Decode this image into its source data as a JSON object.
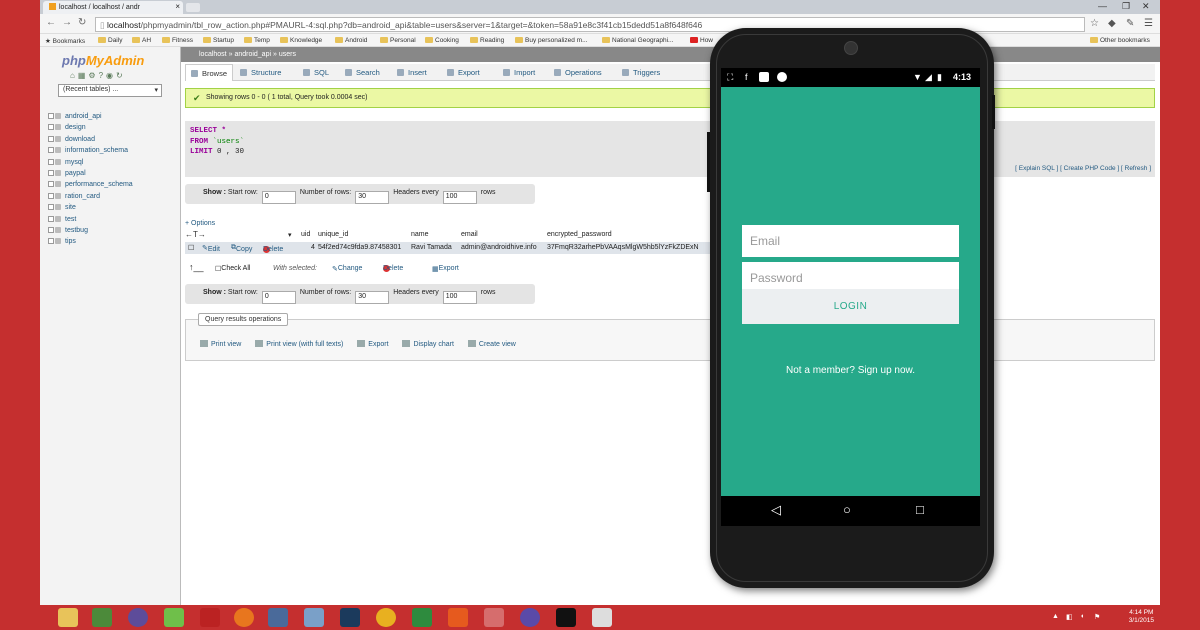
{
  "browser": {
    "tab_title": "localhost / localhost / andr",
    "tab_close": "×",
    "url_host": "localhost",
    "url_path": "/phpmyadmin/tbl_row_action.php#PMAURL-4:sql.php?db=android_api&table=users&server=1&target=&token=58a91e8c3f41cb15dedd51a8f648f646",
    "bookmarks": [
      "Bookmarks",
      "Daily",
      "AH",
      "Fitness",
      "Startup",
      "Temp",
      "Knowledge",
      "Android",
      "Personal",
      "Cooking",
      "Reading",
      "Buy personalized m...",
      "National Geographi...",
      "How"
    ],
    "other_bookmarks": "Other bookmarks"
  },
  "pma": {
    "logo_php": "php",
    "logo_my": "MyAdmin",
    "recent_tables": "(Recent tables) ...",
    "databases": [
      "android_api",
      "design",
      "download",
      "information_schema",
      "mysql",
      "paypal",
      "performance_schema",
      "ration_card",
      "site",
      "test",
      "testbug",
      "tips"
    ],
    "breadcrumb": [
      "localhost",
      "android_api",
      "users"
    ],
    "tabs": [
      "Browse",
      "Structure",
      "SQL",
      "Search",
      "Insert",
      "Export",
      "Import",
      "Operations",
      "Triggers"
    ],
    "success_msg": "Showing rows 0 - 0 ( 1 total, Query took 0.0004 sec)",
    "sql": {
      "select_kw": "SELECT",
      "select_arg": "*",
      "from_kw": "FROM",
      "from_arg": "`users`",
      "limit_kw": "LIMIT",
      "limit_arg": "0 , 30"
    },
    "sql_links": "[ Explain SQL ] [ Create PHP Code ] [ Refresh ]",
    "nav": {
      "show": "Show :",
      "start_row": "Start row:",
      "start_val": "0",
      "num_rows": "Number of rows:",
      "num_val": "30",
      "headers_every": "Headers every",
      "headers_val": "100",
      "rows": "rows"
    },
    "options": "+ Options",
    "column_sort_arrows": "←T→",
    "columns": [
      "uid",
      "unique_id",
      "name",
      "email",
      "encrypted_password"
    ],
    "row": {
      "edit": "Edit",
      "copy": "Copy",
      "delete": "Delete",
      "uid": "4",
      "unique_id": "54f2ed74c9fda9.87458301",
      "name": "Ravi Tamada",
      "email": "admin@androidhive.info",
      "password": "37FmqR32arhePbVAAqsMlgW5hb5lYzFkZDExN"
    },
    "with_selected": {
      "check_all": "Check All",
      "label": "With selected:",
      "change": "Change",
      "delete": "Delete",
      "export": "Export"
    },
    "qro": {
      "title": "Query results operations",
      "links": [
        "Print view",
        "Print view (with full texts)",
        "Export",
        "Display chart",
        "Create view"
      ]
    }
  },
  "phone": {
    "time": "4:13",
    "email_placeholder": "Email",
    "password_placeholder": "Password",
    "login": "LOGIN",
    "signup": "Not a member? Sign up now."
  },
  "taskbar": {
    "time": "4:14 PM",
    "date": "3/1/2015"
  },
  "colors": {
    "accent_teal": "#26a98a",
    "frame_red": "#c52f2f",
    "pma_link": "#235a81"
  }
}
